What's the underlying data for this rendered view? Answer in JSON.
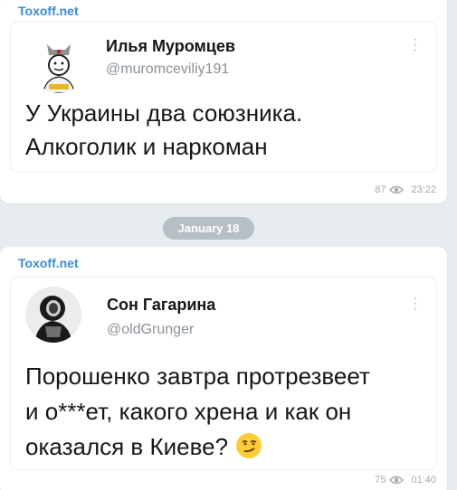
{
  "messages": [
    {
      "channel": "Toxoff.net",
      "tweet": {
        "name": "Илья Муромцев",
        "handle": "@muromceviliy191",
        "text_lines": [
          "У Украины два союзника.",
          "Алкоголик и наркоман"
        ]
      },
      "views": "87",
      "time": "23:22"
    },
    {
      "channel": "Toxoff.net",
      "tweet": {
        "name": "Сон Гагарина",
        "handle": "@oldGrunger",
        "text_lines": [
          "Порошенко завтра протрезвеет",
          "и о***ет, какого хрена и как он",
          "оказался в Киеве?"
        ]
      },
      "views": "75",
      "time": "01:40"
    }
  ],
  "date_separator": "January 18",
  "colors": {
    "background": "#e6ebee",
    "channel": "#3a8bd8",
    "date_pill": "#b7bfc6"
  },
  "icons": {
    "views": "eye-icon",
    "menu": "more-vertical-icon",
    "emoji": "smirking-face-emoji"
  }
}
